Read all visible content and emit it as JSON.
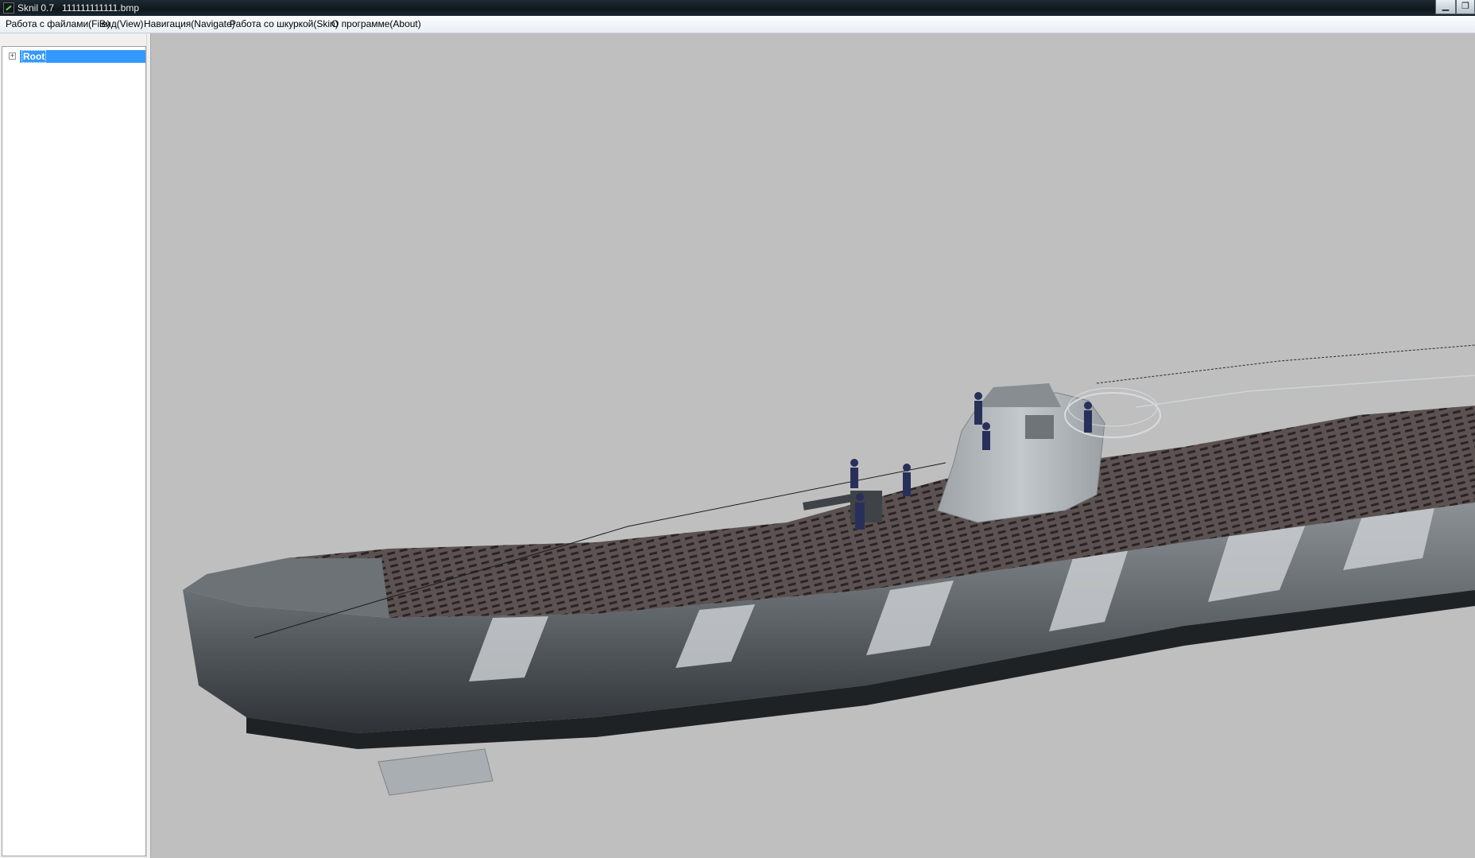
{
  "window": {
    "title": "Sknil 0.7   111111111111.bmp",
    "minimize_glyph": "▁",
    "maximize_glyph": "❐"
  },
  "menu": [
    {
      "label": "Работа с файлами(File)"
    },
    {
      "label": "Вид(View)"
    },
    {
      "label": "Навигация(Navigate)"
    },
    {
      "label": "Работа со шкуркой(Skin)"
    },
    {
      "label": "О программе(About)"
    }
  ],
  "tree": {
    "root_label": "Root",
    "expander": "+"
  },
  "viewport": {
    "background": "#bfbfbf",
    "model": "submarine-3d-model"
  },
  "colors": {
    "selection": "#3399ff",
    "hull_light": "#9aa0a4",
    "hull_dark": "#3b4044",
    "deck": "#5a5050",
    "tower": "#b4b9bd",
    "crew": "#28305a"
  },
  "icons": {
    "app": "app-icon",
    "tree_expand": "plus-box-icon"
  }
}
